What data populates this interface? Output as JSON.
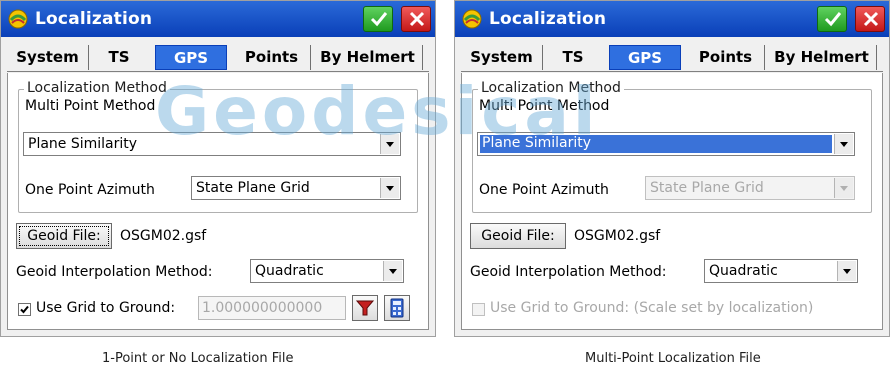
{
  "left_panel": {
    "window": {
      "title": "Localization"
    },
    "tabs": [
      "System",
      "TS",
      "GPS",
      "Points",
      "By Helmert"
    ],
    "active_tab": "GPS",
    "group": {
      "title": "Localization Method",
      "multi_point_label": "Multi Point Method",
      "multi_point_value": "Plane Similarity",
      "one_point_label": "One Point Azimuth",
      "one_point_value": "State Plane Grid"
    },
    "geoid_button": "Geoid File:",
    "geoid_file": "OSGM02.gsf",
    "interp_label": "Geoid Interpolation Method:",
    "interp_value": "Quadratic",
    "grid_to_ground_label": "Use Grid to Ground:",
    "grid_to_ground_checked": true,
    "grid_to_ground_value": "1.000000000000",
    "tools": [
      "filter-icon",
      "calculator-icon"
    ]
  },
  "right_panel": {
    "window": {
      "title": "Localization"
    },
    "tabs": [
      "System",
      "TS",
      "GPS",
      "Points",
      "By Helmert"
    ],
    "active_tab": "GPS",
    "group": {
      "title": "Localization Method",
      "multi_point_label": "Multi Point Method",
      "multi_point_value": "Plane Similarity",
      "one_point_label": "One Point Azimuth",
      "one_point_value": "State Plane Grid"
    },
    "geoid_button": "Geoid File:",
    "geoid_file": "OSGM02.gsf",
    "interp_label": "Geoid Interpolation Method:",
    "interp_value": "Quadratic",
    "grid_to_ground_label": "Use Grid to Ground: (Scale set by localization)",
    "grid_to_ground_checked": false
  },
  "captions": {
    "left": "1-Point or No Localization File",
    "right": "Multi-Point Localization File"
  },
  "watermark": "Geodesical",
  "colors": {
    "titlebar": "#0a3fb8",
    "active_tab": "#2f6fe0",
    "ok_button": "#1f9a1f",
    "close_button": "#c41818",
    "selection": "#3a72d8",
    "watermark": "#69aad7"
  }
}
